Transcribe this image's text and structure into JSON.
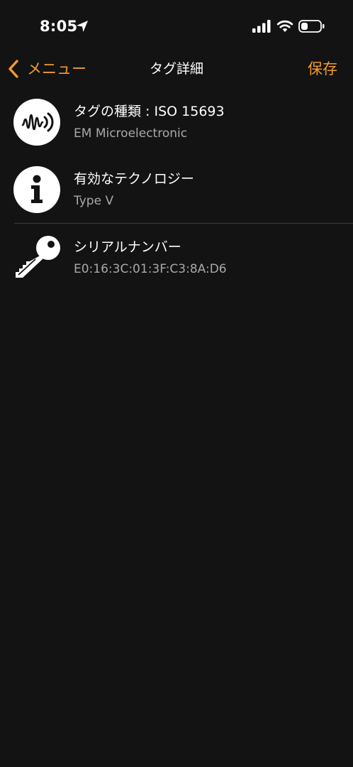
{
  "status_bar": {
    "time": "8:05",
    "icons": [
      "location-arrow-icon",
      "cellular-signal-icon",
      "wifi-icon",
      "battery-icon"
    ]
  },
  "nav": {
    "back_label": "メニュー",
    "title": "タグ詳細",
    "save_label": "保存"
  },
  "items": [
    {
      "icon": "nfc-tag-icon",
      "title": "タグの種類 : ISO 15693",
      "subtitle": "EM Microelectronic"
    },
    {
      "icon": "info-icon",
      "title": "有効なテクノロジー",
      "subtitle": "Type V"
    },
    {
      "icon": "key-icon",
      "title": "シリアルナンバー",
      "subtitle": "E0:16:3C:01:3F:C3:8A:D6"
    }
  ],
  "colors": {
    "background": "#131313",
    "accent": "#f29a2e",
    "text": "#ffffff",
    "secondary_text": "#a9a9a9",
    "separator": "#3a3a3a"
  }
}
